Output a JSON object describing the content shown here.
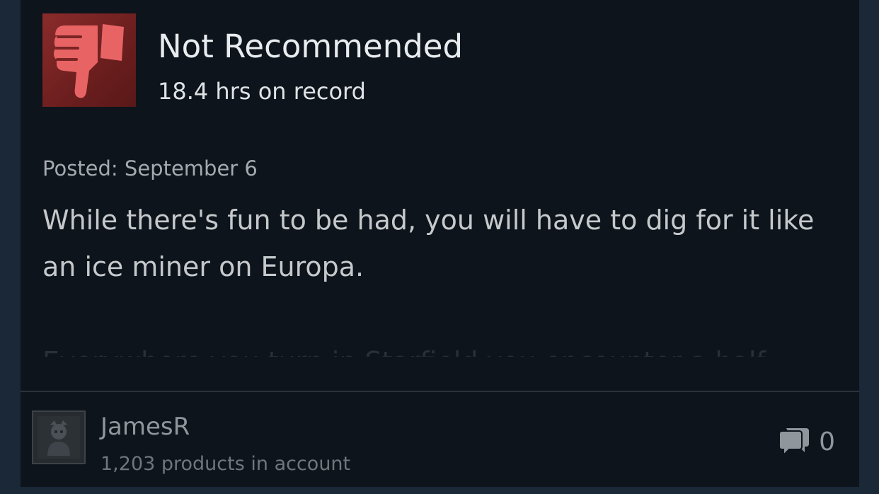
{
  "review": {
    "recommendation": "Not Recommended",
    "recommendation_icon": "thumbs-down-icon",
    "hours": "18.4 hrs on record",
    "posted": "Posted: September 6",
    "text": "While there's fun to be had, you will have to dig for it like an ice miner on Europa.",
    "faded_text": "Everywhere you turn in Starfield you encounter a half"
  },
  "author": {
    "username": "JamesR",
    "products": "1,203 products in account",
    "avatar_icon": "avatar"
  },
  "comments": {
    "icon": "comment-bubbles-icon",
    "count": "0"
  },
  "colors": {
    "background": "#1b2838",
    "card": "#0e141b",
    "thumb_red": "#e05a5a",
    "thumb_box": "#7a2424"
  }
}
